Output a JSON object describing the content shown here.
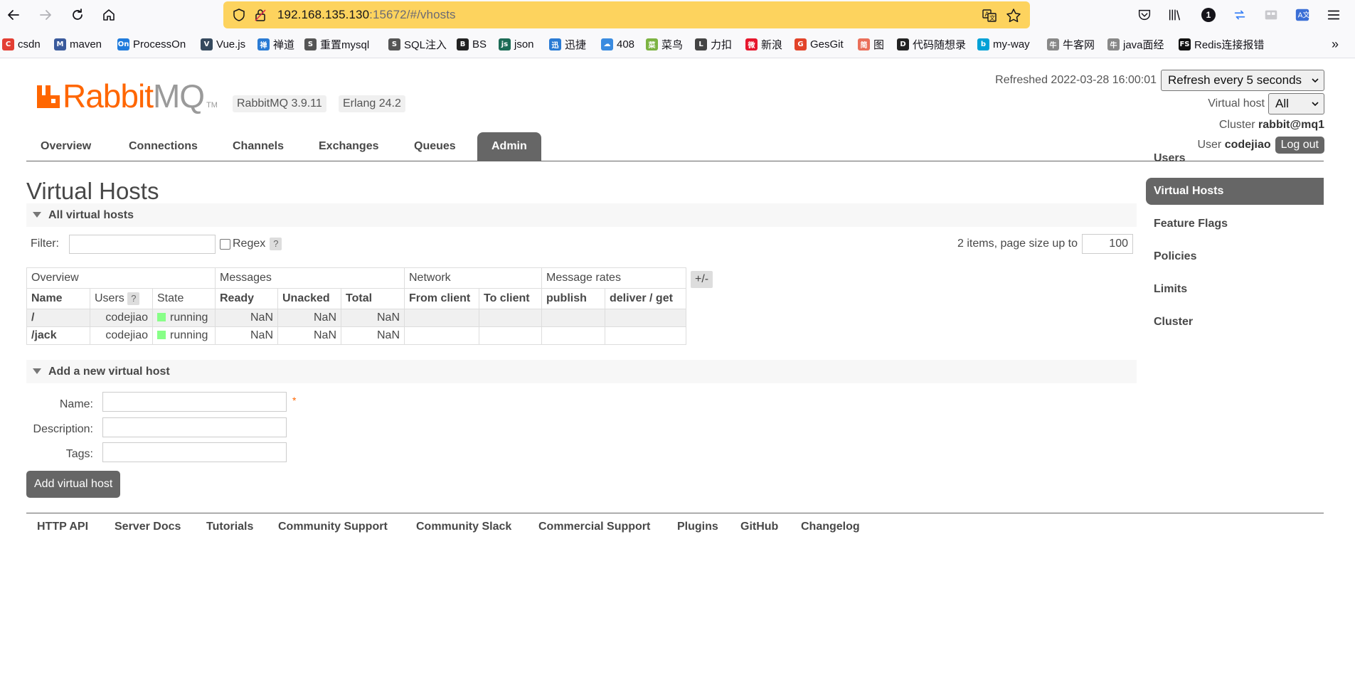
{
  "browser": {
    "url_host": "192.168.135.130",
    "url_rest": ":15672/#/vhosts",
    "notification_count": "1",
    "bookmarks": [
      {
        "label": "csdn",
        "icon": "csdn-icon",
        "color": "#e33e33",
        "glyph": "C"
      },
      {
        "label": "maven",
        "icon": "maven-icon",
        "color": "#3a5a9c",
        "glyph": "M"
      },
      {
        "label": "ProcessOn",
        "icon": "processon-icon",
        "color": "#1f7bdc",
        "glyph": "On"
      },
      {
        "label": "Vue.js",
        "icon": "vue-icon",
        "color": "#35495e",
        "glyph": "V"
      },
      {
        "label": "禅道",
        "icon": "zentao-icon",
        "color": "#2a7bd4",
        "glyph": "禅"
      },
      {
        "label": "重置mysql",
        "icon": "mysql-icon",
        "color": "#555555",
        "glyph": "S"
      },
      {
        "label": "SQL注入",
        "icon": "sql-icon",
        "color": "#555555",
        "glyph": "S"
      },
      {
        "label": "BS",
        "icon": "bootstrap-icon",
        "color": "#222222",
        "glyph": "B"
      },
      {
        "label": "json",
        "icon": "json-icon",
        "color": "#1c6b56",
        "glyph": "js"
      },
      {
        "label": "迅捷",
        "icon": "xunjie-icon",
        "color": "#2a7bd4",
        "glyph": "迅"
      },
      {
        "label": "408",
        "icon": "cloud-icon",
        "color": "#3a8be0",
        "glyph": "☁"
      },
      {
        "label": "菜鸟",
        "icon": "runoob-icon",
        "color": "#7cb342",
        "glyph": "菜"
      },
      {
        "label": "力扣",
        "icon": "leetcode-icon",
        "color": "#444444",
        "glyph": "L"
      },
      {
        "label": "新浪",
        "icon": "weibo-icon",
        "color": "#e6162d",
        "glyph": "微"
      },
      {
        "label": "GesGit",
        "icon": "gitlab-icon",
        "color": "#e24329",
        "glyph": "G"
      },
      {
        "label": "图",
        "icon": "jianshu-icon",
        "color": "#ea6f5a",
        "glyph": "简"
      },
      {
        "label": "代码随想录",
        "icon": "daima-icon",
        "color": "#222222",
        "glyph": "D"
      },
      {
        "label": "my-way",
        "icon": "bilibili-icon",
        "color": "#00a1d6",
        "glyph": "b"
      },
      {
        "label": "牛客网",
        "icon": "nowcoder-icon",
        "color": "#888888",
        "glyph": "牛"
      },
      {
        "label": "java面经",
        "icon": "nowcoder-icon-2",
        "color": "#888888",
        "glyph": "牛"
      },
      {
        "label": "Redis连接报错",
        "icon": "fs-icon",
        "color": "#111111",
        "glyph": "FS"
      }
    ]
  },
  "app": {
    "logo_rabbit": "Rabbit",
    "logo_mq": "MQ",
    "logo_tm": "TM",
    "version": "RabbitMQ 3.9.11",
    "erlang": "Erlang 24.2",
    "refreshed_label": "Refreshed 2022-03-28 16:00:01",
    "refresh_select": "Refresh every 5 seconds",
    "vhost_label": "Virtual host",
    "vhost_select": "All",
    "cluster_label": "Cluster",
    "cluster_name": "rabbit@mq1",
    "user_label": "User",
    "user_name": "codejiao",
    "logout": "Log out",
    "accent_color": "#ff6600",
    "active_tab_color": "#666666"
  },
  "tabs": [
    "Overview",
    "Connections",
    "Channels",
    "Exchanges",
    "Queues",
    "Admin"
  ],
  "active_tab": "Admin",
  "main": {
    "title": "Virtual Hosts",
    "all_section": "All virtual hosts",
    "filter_label": "Filter:",
    "regex_label": "Regex",
    "help_mark": "?",
    "page_info": "2 items, page size up to",
    "page_size": "100",
    "plus_minus": "+/-",
    "table": {
      "groups": [
        "Overview",
        "Messages",
        "Network",
        "Message rates"
      ],
      "columns": [
        "Name",
        "Users",
        "State",
        "Ready",
        "Unacked",
        "Total",
        "From client",
        "To client",
        "publish",
        "deliver / get"
      ],
      "rows": [
        {
          "name": "/",
          "users": "codejiao",
          "state": "running",
          "ready": "NaN",
          "unacked": "NaN",
          "total": "NaN",
          "from_client": "",
          "to_client": "",
          "publish": "",
          "deliver_get": ""
        },
        {
          "name": "/jack",
          "users": "codejiao",
          "state": "running",
          "ready": "NaN",
          "unacked": "NaN",
          "total": "NaN",
          "from_client": "",
          "to_client": "",
          "publish": "",
          "deliver_get": ""
        }
      ]
    },
    "add_section": "Add a new virtual host",
    "form": {
      "name_label": "Name:",
      "description_label": "Description:",
      "tags_label": "Tags:",
      "required_mark": "*",
      "submit": "Add virtual host"
    }
  },
  "sidebar": [
    "Users",
    "Virtual Hosts",
    "Feature Flags",
    "Policies",
    "Limits",
    "Cluster"
  ],
  "sidebar_active": "Virtual Hosts",
  "footer": [
    "HTTP API",
    "Server Docs",
    "Tutorials",
    "Community Support",
    "Community Slack",
    "Commercial Support",
    "Plugins",
    "GitHub",
    "Changelog"
  ]
}
